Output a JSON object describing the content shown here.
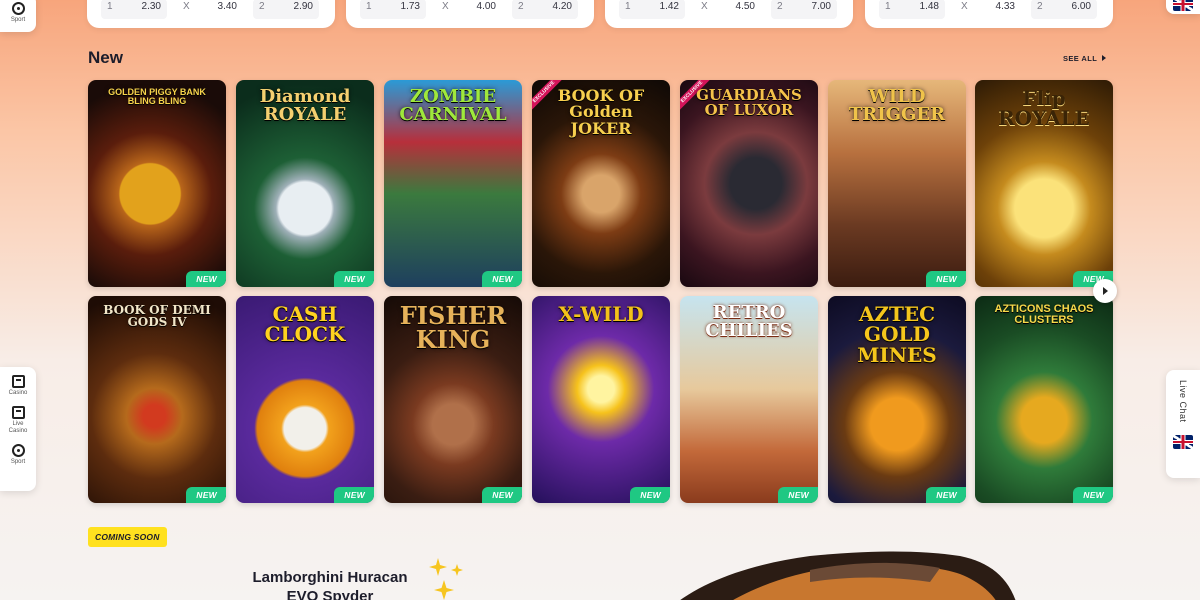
{
  "odds_cards": [
    {
      "cells": [
        {
          "k": "1",
          "v": "2.30"
        },
        {
          "k": "X",
          "v": "3.40"
        },
        {
          "k": "2",
          "v": "2.90"
        }
      ]
    },
    {
      "cells": [
        {
          "k": "1",
          "v": "1.73"
        },
        {
          "k": "X",
          "v": "4.00"
        },
        {
          "k": "2",
          "v": "4.20"
        }
      ]
    },
    {
      "cells": [
        {
          "k": "1",
          "v": "1.42"
        },
        {
          "k": "X",
          "v": "4.50"
        },
        {
          "k": "2",
          "v": "7.00"
        }
      ]
    },
    {
      "cells": [
        {
          "k": "1",
          "v": "1.48"
        },
        {
          "k": "X",
          "v": "4.33"
        },
        {
          "k": "2",
          "v": "6.00"
        }
      ]
    }
  ],
  "left_rail_top": {
    "label": "Sport",
    "icon": "soccer-ball-icon"
  },
  "left_rail": [
    {
      "label": "Casino",
      "icon": "slot-machine-icon"
    },
    {
      "label": "Live Casino",
      "icon": "playing-cards-icon"
    },
    {
      "label": "Sport",
      "icon": "soccer-ball-icon"
    }
  ],
  "right_rail": {
    "live_chat": "Live Chat",
    "language_icon": "uk-flag-icon"
  },
  "section": {
    "title": "New",
    "see_all": "SEE ALL"
  },
  "games": [
    {
      "title": "GOLDEN PIGGY BANK BLING BLING",
      "badge": "NEW",
      "exclusive": false
    },
    {
      "title": "Diamond ROYALE",
      "badge": "NEW",
      "exclusive": false
    },
    {
      "title": "ZOMBIE CARNIVAL",
      "badge": "NEW",
      "exclusive": false
    },
    {
      "title": "BOOK OF Golden JOKER",
      "badge": "",
      "exclusive": true
    },
    {
      "title": "GUARDIANS OF LUXOR",
      "badge": "",
      "exclusive": true
    },
    {
      "title": "WILD TRIGGER",
      "badge": "NEW",
      "exclusive": false
    },
    {
      "title": "Flip ROYALE",
      "badge": "NEW",
      "exclusive": false
    },
    {
      "title": "BOOK OF DEMI GODS IV",
      "badge": "NEW",
      "exclusive": false
    },
    {
      "title": "CASH CLOCK",
      "badge": "NEW",
      "exclusive": false
    },
    {
      "title": "FISHER KING",
      "badge": "NEW",
      "exclusive": false
    },
    {
      "title": "X-WILD",
      "badge": "NEW",
      "exclusive": false
    },
    {
      "title": "RETRO CHILIES",
      "badge": "NEW",
      "exclusive": false
    },
    {
      "title": "AZTEC GOLD MINES",
      "badge": "NEW",
      "exclusive": false
    },
    {
      "title": "AZTICONS CHAOS CLUSTERS",
      "badge": "NEW",
      "exclusive": false
    }
  ],
  "exclusive_label": "EXCLUSIVE",
  "coming_soon": {
    "badge": "COMING SOON",
    "title": "Lamborghini Huracan EVO Spyder"
  },
  "colors": {
    "new_badge": "#1fc883",
    "coming_soon": "#ffe11f",
    "exclusive": "#d4145a"
  }
}
